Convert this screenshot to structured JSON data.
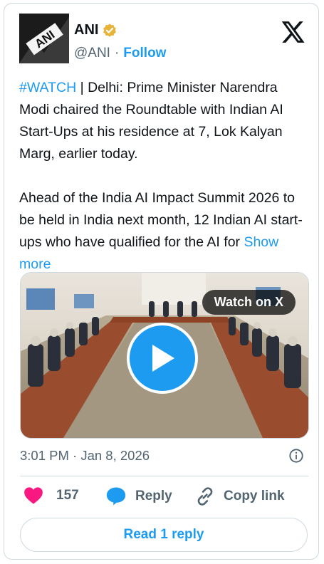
{
  "author": {
    "name": "ANI",
    "handle": "@ANI",
    "separator": "·",
    "follow_label": "Follow",
    "avatar_text": "ANI",
    "verified_icon": "verified-gold-badge-icon"
  },
  "tweet": {
    "hashtag": "#WATCH",
    "line1_rest": " | Delhi: Prime Minister Narendra Modi chaired the Roundtable with Indian AI Start-Ups at his residence at 7, Lok Kalyan Marg, earlier today.",
    "para2": "Ahead of the India AI Impact Summit 2026 to be held in India next month, 12 Indian AI start-ups who have qualified for the AI for ",
    "show_more": "Show more"
  },
  "media": {
    "watch_label": "Watch on X",
    "play_icon": "play-icon"
  },
  "meta": {
    "timestamp": "3:01 PM · Jan 8, 2026",
    "info_icon": "info-icon"
  },
  "actions": {
    "likes_count": "157",
    "reply_label": "Reply",
    "copy_link_label": "Copy link"
  },
  "footer": {
    "read_reply_label": "Read 1 reply"
  },
  "colors": {
    "accent": "#1d9bf0",
    "like": "#f91880",
    "verified": "#e8b339",
    "muted": "#536471"
  }
}
